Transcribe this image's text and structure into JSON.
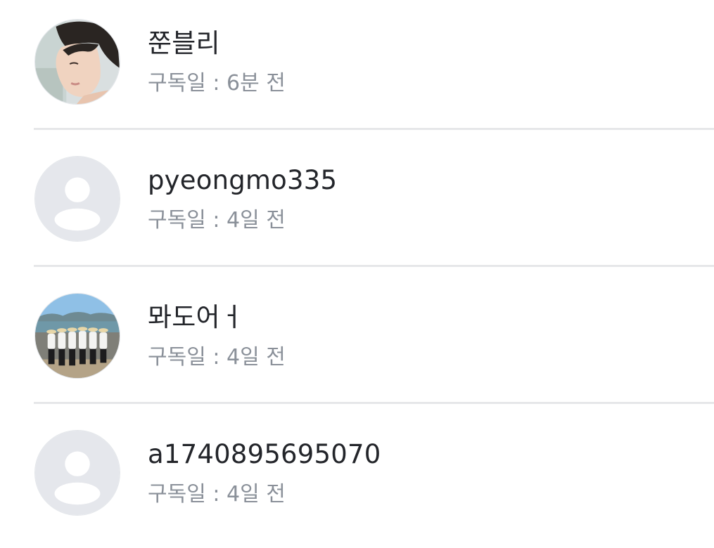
{
  "subscribers": [
    {
      "name": "쭌블리",
      "subscribed_label": "구독일 : 6분 전",
      "avatar_icon": "profile-photo-person"
    },
    {
      "name": "pyeongmo335",
      "subscribed_label": "구독일 : 4일 전",
      "avatar_icon": "default-user-icon"
    },
    {
      "name": "뫄도어ㅓ",
      "subscribed_label": "구독일 : 4일 전",
      "avatar_icon": "profile-photo-group-beach"
    },
    {
      "name": "a1740895695070",
      "subscribed_label": "구독일 : 4일 전",
      "avatar_icon": "default-user-icon"
    }
  ],
  "colors": {
    "name_text": "#23252a",
    "sub_text": "#8a9099",
    "divider": "#e6e7e9",
    "placeholder_bg": "#e5e7ec",
    "placeholder_fg": "#ffffff"
  }
}
